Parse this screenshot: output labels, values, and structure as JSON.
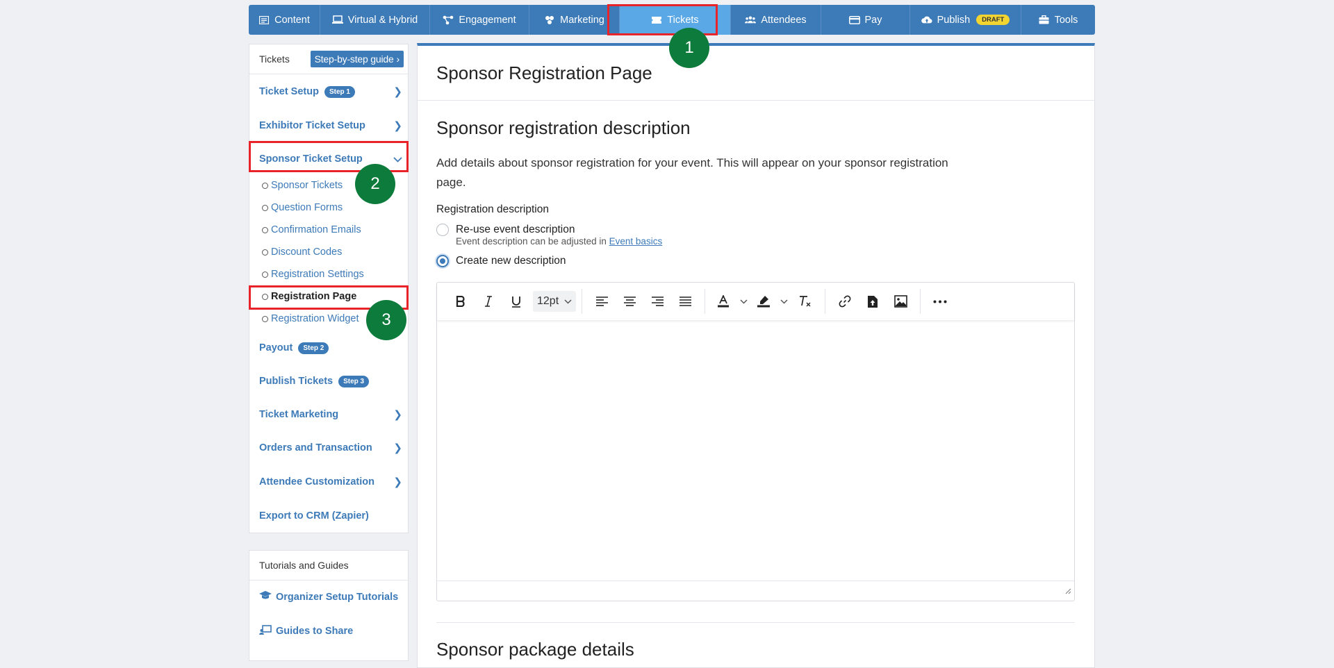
{
  "topnav": {
    "tabs": [
      {
        "label": "Content",
        "icon": "content-icon"
      },
      {
        "label": "Virtual & Hybrid",
        "icon": "monitor-icon"
      },
      {
        "label": "Engagement",
        "icon": "nodes-icon"
      },
      {
        "label": "Marketing",
        "icon": "megaphone-icon"
      },
      {
        "label": "Tickets",
        "icon": "ticket-icon",
        "active": true
      },
      {
        "label": "Attendees",
        "icon": "users-icon"
      },
      {
        "label": "Pay",
        "icon": "card-icon"
      },
      {
        "label": "Publish",
        "icon": "cloud-upload-icon",
        "badge": "DRAFT"
      },
      {
        "label": "Tools",
        "icon": "toolbox-icon"
      }
    ]
  },
  "sidebar": {
    "title": "Tickets",
    "guide_button": "Step-by-step guide",
    "items": [
      {
        "label": "Ticket Setup",
        "badge": "Step 1",
        "chevron": "right"
      },
      {
        "label": "Exhibitor Ticket Setup",
        "chevron": "right"
      },
      {
        "label": "Sponsor Ticket Setup",
        "chevron": "down"
      },
      {
        "label": "Payout",
        "badge": "Step 2"
      },
      {
        "label": "Publish Tickets",
        "badge": "Step 3"
      },
      {
        "label": "Ticket Marketing",
        "chevron": "right"
      },
      {
        "label": "Orders and Transaction",
        "chevron": "right"
      },
      {
        "label": "Attendee Customization",
        "chevron": "right"
      },
      {
        "label": "Export to CRM (Zapier)"
      }
    ],
    "sponsor_subitems": [
      "Sponsor Tickets",
      "Question Forms",
      "Confirmation Emails",
      "Discount Codes",
      "Registration Settings",
      "Registration Page",
      "Registration Widget"
    ],
    "current_subitem": "Registration Page"
  },
  "tutorials": {
    "title": "Tutorials and Guides",
    "items": [
      {
        "label": "Organizer Setup Tutorials",
        "icon": "graduation-cap-icon"
      },
      {
        "label": "Guides to Share",
        "icon": "share-screen-icon"
      }
    ]
  },
  "annotations": {
    "markers": [
      "1",
      "2",
      "3"
    ],
    "highlight_color": "#e8232a",
    "marker_color": "#0d7b3b"
  },
  "main": {
    "page_title": "Sponsor Registration Page",
    "section_title": "Sponsor registration description",
    "section_description": "Add details about sponsor registration for your event. This will appear on your sponsor registration page.",
    "field_label": "Registration description",
    "radio_options": [
      {
        "label": "Re-use event description",
        "checked": false,
        "hint": "Event description can be adjusted in",
        "hint_link": "Event basics"
      },
      {
        "label": "Create new description",
        "checked": true
      }
    ],
    "editor": {
      "font_size": "12pt",
      "content": ""
    },
    "next_section_title": "Sponsor package details"
  },
  "colors": {
    "primary": "#3d7ab8",
    "active_tab": "#5ba8e6",
    "draft_badge": "#f3d531",
    "background": "#eef0f3"
  }
}
